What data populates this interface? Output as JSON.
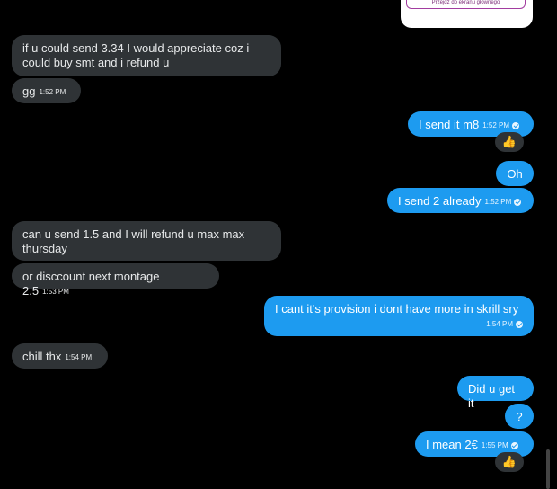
{
  "image_card": {
    "button_text": "Przejdź do ekranu głównego"
  },
  "messages": [
    {
      "text": "if u could send 3.34 I would appreciate coz i could buy smt and i refund u",
      "time": ""
    },
    {
      "text": "gg",
      "time": "1:52 PM"
    },
    {
      "text": "I send it m8",
      "time": "1:52 PM",
      "reaction": "👍"
    },
    {
      "text": "Oh",
      "time": ""
    },
    {
      "text": "I send 2 already",
      "time": "1:52 PM"
    },
    {
      "text": "can u send 1.5 and I will refund u max max thursday",
      "time": ""
    },
    {
      "text": "or disccount next montage 2.5",
      "time": "1:53 PM"
    },
    {
      "text": "I cant it's provision i dont have more in skrill sry",
      "time": "1:54 PM"
    },
    {
      "text": "chill thx",
      "time": "1:54 PM"
    },
    {
      "text": "Did u get it",
      "time": ""
    },
    {
      "text": "?",
      "time": ""
    },
    {
      "text": "I mean 2€",
      "time": "1:55 PM",
      "reaction": "👍"
    }
  ]
}
